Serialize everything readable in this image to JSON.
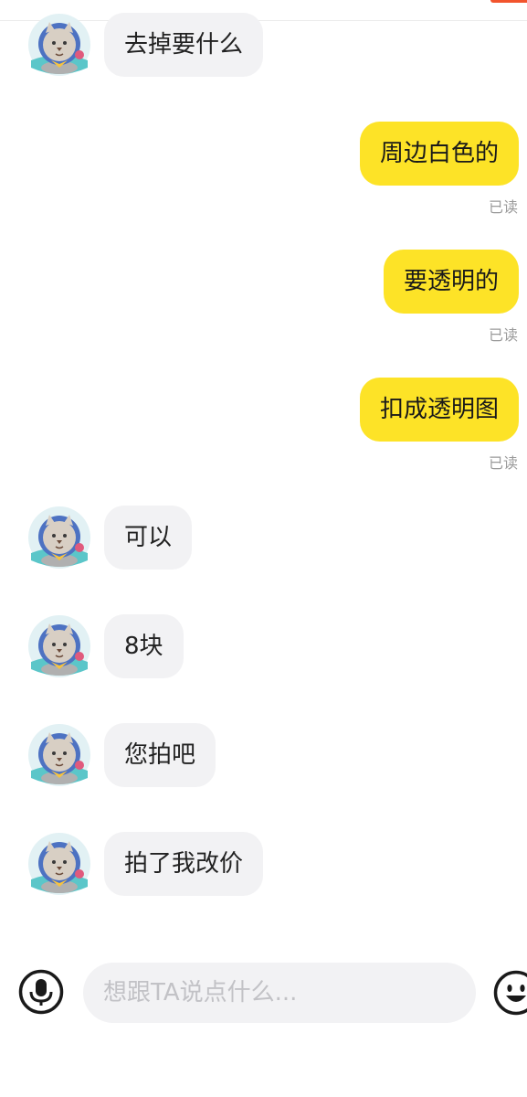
{
  "theme": {
    "incoming_bubble": "#f2f2f4",
    "outgoing_bubble": "#fde327",
    "read_receipt": "#9a9a9a",
    "accent": "#f2542d"
  },
  "messages": [
    {
      "direction": "in",
      "text": "去掉要什么"
    },
    {
      "direction": "out",
      "text": "周边白色的",
      "status": "已读"
    },
    {
      "direction": "out",
      "text": "要透明的",
      "status": "已读"
    },
    {
      "direction": "out",
      "text": "扣成透明图",
      "status": "已读"
    },
    {
      "direction": "in",
      "text": "可以"
    },
    {
      "direction": "in",
      "text": "8块"
    },
    {
      "direction": "in",
      "text": "您拍吧"
    },
    {
      "direction": "in",
      "text": "拍了我改价"
    }
  ],
  "input": {
    "placeholder": "想跟TA说点什么...",
    "value": ""
  },
  "icons": {
    "voice": "microphone-icon",
    "emoji": "smiley-face-icon",
    "avatar": "cat-astronaut-avatar"
  }
}
